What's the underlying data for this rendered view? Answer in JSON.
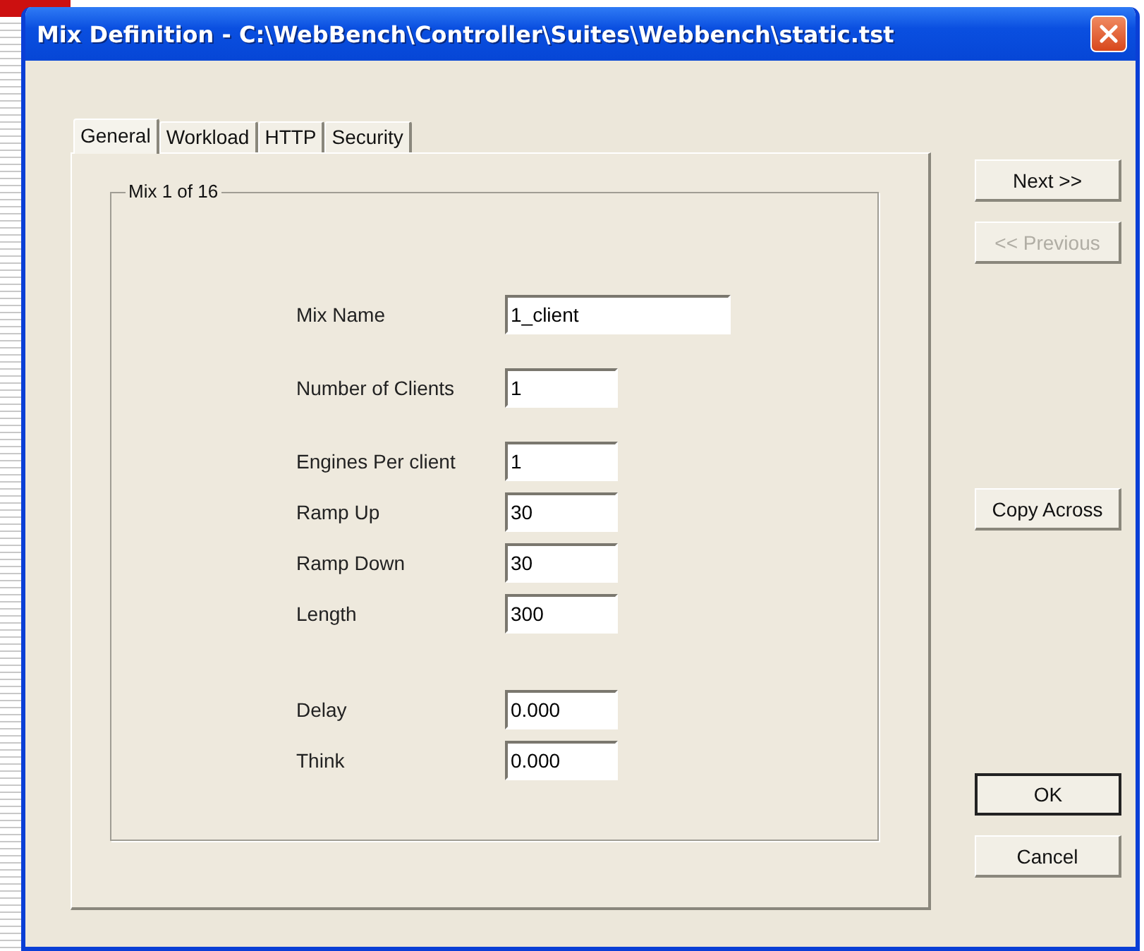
{
  "window": {
    "title": "Mix Definition - C:\\WebBench\\Controller\\Suites\\Webbench\\static.tst"
  },
  "tabs": [
    {
      "label": "General",
      "selected": true
    },
    {
      "label": "Workload",
      "selected": false
    },
    {
      "label": "HTTP",
      "selected": false
    },
    {
      "label": "Security",
      "selected": false
    }
  ],
  "group": {
    "title": "Mix 1 of 16",
    "field_groups": [
      [
        {
          "label": "Mix Name",
          "value": "1_client",
          "kind": "wide"
        },
        {
          "label": "Number of Clients",
          "value": "1",
          "kind": "narrow"
        },
        {
          "label": "Engines Per client",
          "value": "1",
          "kind": "narrow"
        },
        {
          "label": "Ramp Up",
          "value": "30",
          "kind": "narrow"
        },
        {
          "label": "Ramp Down",
          "value": "30",
          "kind": "narrow"
        },
        {
          "label": "Length",
          "value": "300",
          "kind": "narrow"
        }
      ],
      [
        {
          "label": "Delay",
          "value": "0.000",
          "kind": "narrow"
        },
        {
          "label": "Think",
          "value": "0.000",
          "kind": "narrow"
        }
      ]
    ]
  },
  "buttons": [
    {
      "label": "Next >>",
      "disabled": false,
      "default": false
    },
    {
      "label": "<< Previous",
      "disabled": true,
      "default": false
    },
    {
      "label": "Copy Across",
      "disabled": false,
      "default": false
    },
    {
      "label": "OK",
      "disabled": false,
      "default": true
    },
    {
      "label": "Cancel",
      "disabled": false,
      "default": false
    }
  ]
}
